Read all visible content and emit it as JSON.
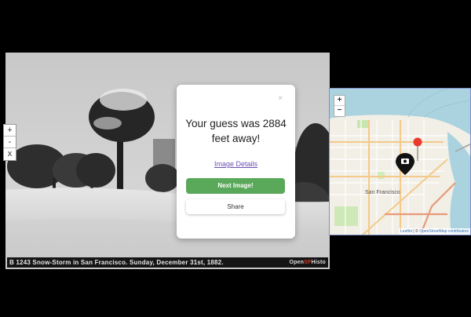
{
  "photo": {
    "caption": "B 1243   Snow-Storm in San Francisco.  Sunday, December 31st, 1882.",
    "watermark_a": "Open",
    "watermark_b": "SF",
    "watermark_c": "Histo"
  },
  "photo_zoom": {
    "in": "+",
    "out": "-",
    "reset": "x"
  },
  "modal": {
    "close": "×",
    "message": "Your guess was 2884 feet away!",
    "details_link": "Image Details",
    "next_button": "Next Image!",
    "share_button": "Share"
  },
  "map": {
    "zoom_in": "+",
    "zoom_out": "−",
    "city_label": "San Francisco",
    "attribution_leaflet": "Leaflet",
    "attribution_sep": " | © ",
    "attribution_osm": "OpenStreetMap contributors"
  },
  "colors": {
    "next_button": "#5aa85a",
    "link": "#6a4fb3",
    "water": "#aad3df",
    "guess_marker": "#e83a2e"
  }
}
